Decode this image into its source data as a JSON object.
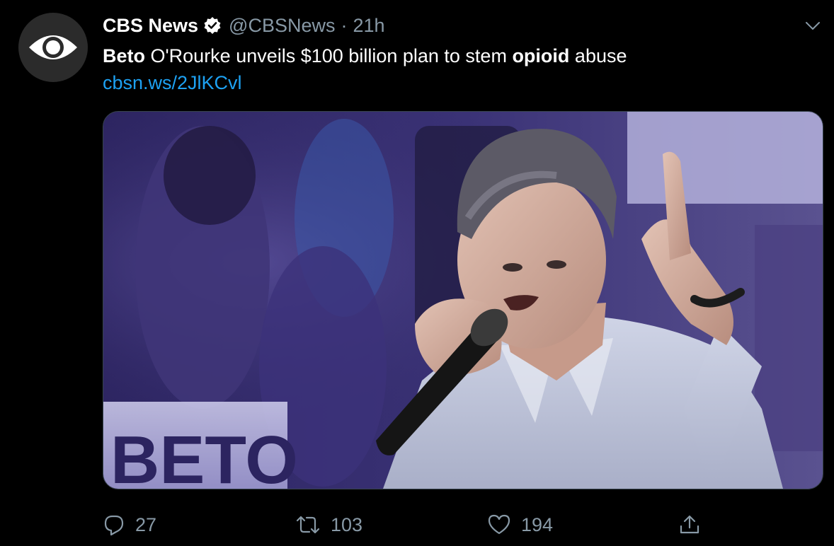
{
  "tweet": {
    "display_name": "CBS News",
    "verified": true,
    "handle": "@CBSNews",
    "separator": "·",
    "time": "21h",
    "text": {
      "bold1": "Beto",
      "mid": " O'Rourke unveils $100 billion plan to stem ",
      "bold2": "opioid",
      "end": " abuse"
    },
    "link": "cbsn.ws/2JlKCvl",
    "media_sign_text": "BETO"
  },
  "actions": {
    "reply_count": "27",
    "retweet_count": "103",
    "like_count": "194"
  },
  "icons": {
    "avatar": "cbs-eye-logo",
    "verified": "verified-badge-icon",
    "menu": "chevron-down-icon",
    "reply": "reply-icon",
    "retweet": "retweet-icon",
    "like": "heart-icon",
    "share": "share-icon"
  },
  "colors": {
    "background": "#000000",
    "text": "#ffffff",
    "muted": "#8899a6",
    "link": "#1da1f2",
    "border": "#38444d"
  }
}
